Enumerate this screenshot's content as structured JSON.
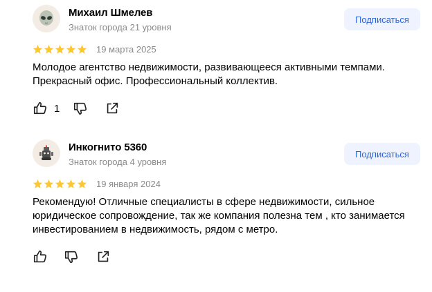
{
  "colors": {
    "star": "#fdc72f",
    "subscribe_bg": "#eef3ff",
    "subscribe_text": "#2b64d9",
    "muted": "#8a8a8a"
  },
  "reviews": [
    {
      "author": "Михаил Шмелев",
      "level": "Знаток города 21 уровня",
      "subscribe_label": "Подписаться",
      "avatar_icon": "alien-icon",
      "rating": 5,
      "date": "19 марта 2025",
      "text": "Молодое агентство недвижимости, развивающееся активными темпами. Прекрасный офис. Профессиональный коллектив.",
      "likes": "1"
    },
    {
      "author": "Инкогнито 5360",
      "level": "Знаток города 4 уровня",
      "subscribe_label": "Подписаться",
      "avatar_icon": "robot-icon",
      "rating": 5,
      "date": "19 января 2024",
      "text": "Рекомендую! Отличные специалисты в сфере недвижимости, сильное юридическое сопровождение, так же компания полезна тем , кто занимается инвестированием в недвижимость, рядом с метро.",
      "likes": ""
    }
  ]
}
